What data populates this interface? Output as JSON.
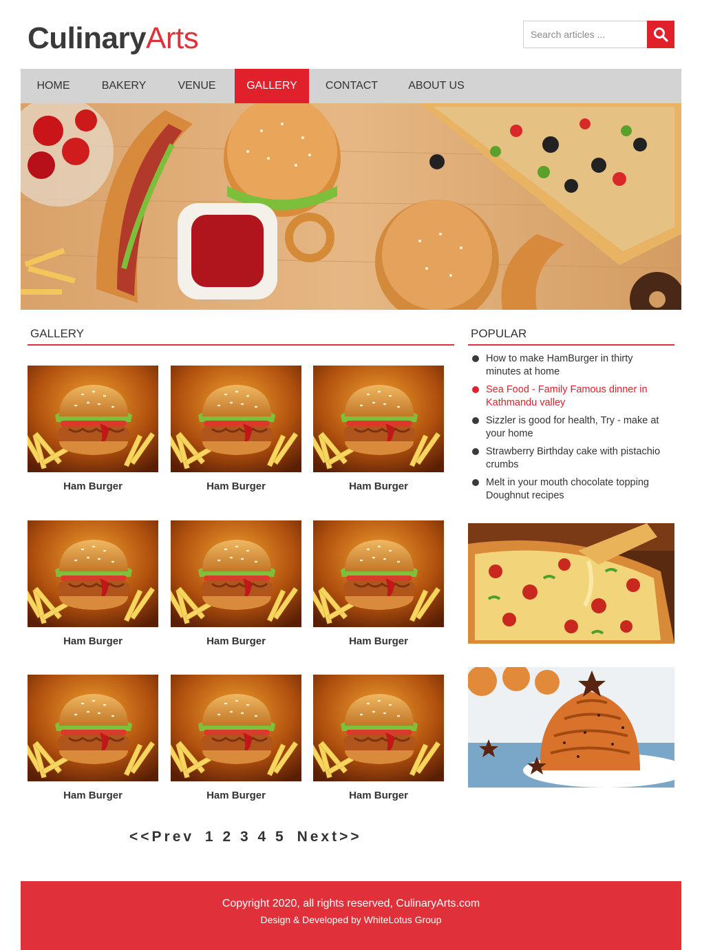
{
  "header": {
    "logo_part1": "Culinary",
    "logo_part2": "Arts"
  },
  "search": {
    "placeholder": "Search articles ...",
    "icon": "search-icon"
  },
  "nav": {
    "items": [
      {
        "label": "HOME"
      },
      {
        "label": "BAKERY"
      },
      {
        "label": "VENUE"
      },
      {
        "label": "GALLERY"
      },
      {
        "label": "CONTACT"
      },
      {
        "label": "ABOUT US"
      }
    ],
    "active": "GALLERY"
  },
  "gallery": {
    "title": "GALLERY",
    "items": [
      {
        "caption": "Ham Burger"
      },
      {
        "caption": "Ham Burger"
      },
      {
        "caption": "Ham Burger"
      },
      {
        "caption": "Ham Burger"
      },
      {
        "caption": "Ham Burger"
      },
      {
        "caption": "Ham Burger"
      },
      {
        "caption": "Ham Burger"
      },
      {
        "caption": "Ham Burger"
      },
      {
        "caption": "Ham Burger"
      }
    ]
  },
  "pagination": {
    "prev": "<<Prev",
    "pages": [
      "1",
      "2",
      "3",
      "4",
      "5"
    ],
    "next": "Next>>"
  },
  "popular": {
    "title": "POPULAR",
    "items": [
      {
        "text": "How to make HamBurger in thirty minutes at home"
      },
      {
        "text": "Sea Food - Family Famous dinner in Kathmandu valley"
      },
      {
        "text": "Sizzler is good for health, Try - make at your home"
      },
      {
        "text": "Strawberry Birthday cake with pistachio crumbs"
      },
      {
        "text": "Melt in your mouth chocolate topping Doughnut recipes"
      }
    ]
  },
  "footer": {
    "copyright": "Copyright 2020, all rights reserved, CulinaryArts.com",
    "credit": "Design & Developed by WhiteLotus Group"
  },
  "colors": {
    "accent": "#e0303a",
    "nav_bg": "#d3d3d3",
    "text": "#333333"
  }
}
